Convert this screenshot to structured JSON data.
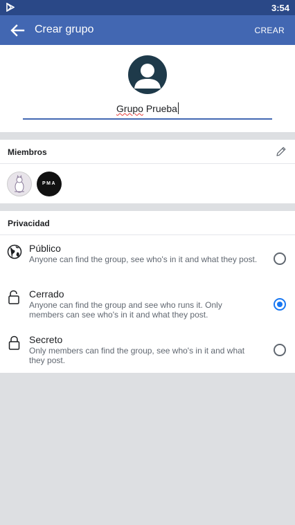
{
  "status_bar": {
    "time": "3:54"
  },
  "app_bar": {
    "title": "Crear grupo",
    "action_label": "CREAR"
  },
  "group_name": {
    "first_word": "Grupo",
    "rest": " Prueba"
  },
  "members": {
    "title": "Miembros",
    "avatars": [
      {
        "name": "member-1"
      },
      {
        "name": "member-2",
        "text": "PMA"
      }
    ]
  },
  "privacy": {
    "title": "Privacidad",
    "options": [
      {
        "label": "Público",
        "description": "Anyone can find the group, see who's in it and what they post.",
        "icon": "globe-icon",
        "selected": false
      },
      {
        "label": "Cerrado",
        "description": "Anyone can find the group and see who runs it. Only members can see who's in it and what they post.",
        "icon": "unlock-icon",
        "selected": true
      },
      {
        "label": "Secreto",
        "description": "Only members can find the group, see who's in it and what they post.",
        "icon": "lock-icon",
        "selected": false
      }
    ]
  },
  "colors": {
    "status_bar": "#2a4887",
    "app_bar": "#4267b2",
    "accent": "#1877f2",
    "background": "#dddfe2"
  }
}
